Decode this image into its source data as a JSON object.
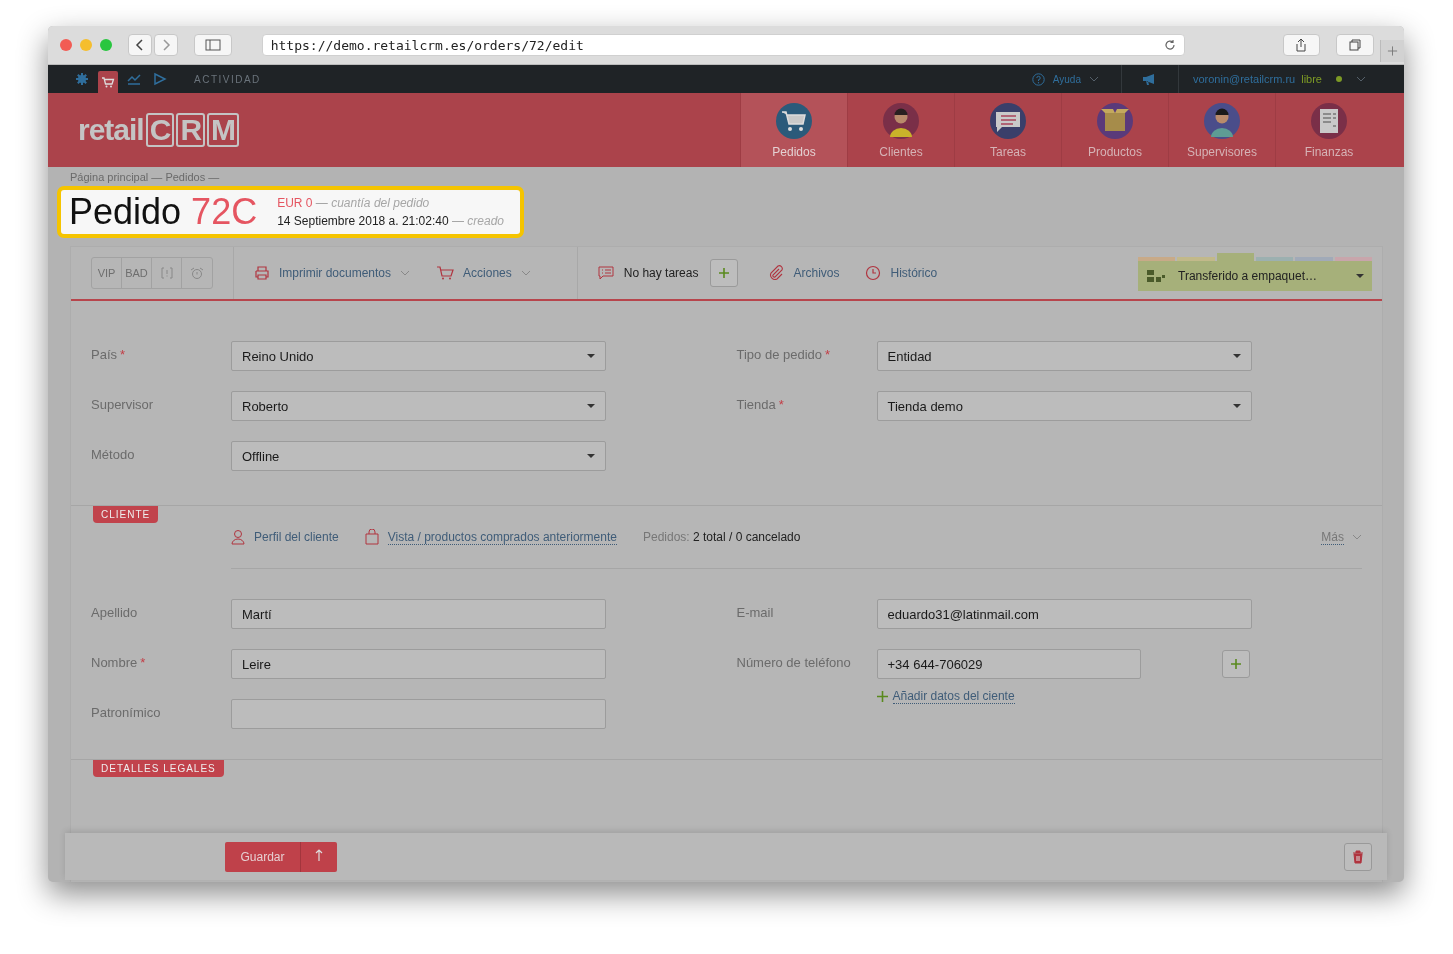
{
  "browser": {
    "url": "https://demo.retailcrm.es/orders/72/edit"
  },
  "topbar": {
    "modules": [
      {
        "selected": false
      },
      {
        "selected": true
      },
      {
        "selected": false
      },
      {
        "selected": false
      }
    ],
    "activity": "ACTIVIDAD",
    "help": "Ayuda",
    "user": "voronin@retailcrm.ru",
    "status": "libre",
    "online": true
  },
  "logo": {
    "word": "retail",
    "letters": [
      "C",
      "R",
      "M"
    ]
  },
  "nav": [
    {
      "label": "Pedidos",
      "selected": true
    },
    {
      "label": "Clientes",
      "selected": false
    },
    {
      "label": "Tareas",
      "selected": false
    },
    {
      "label": "Productos",
      "selected": false
    },
    {
      "label": "Supervisores",
      "selected": false
    },
    {
      "label": "Finanzas",
      "selected": false
    }
  ],
  "page": {
    "breadcrumb": "Página principal — Pedidos —",
    "title": "Pedido",
    "number": "72C",
    "amount": "EUR 0",
    "amount_note": "— cuantía del pedido",
    "date": "14 Septiembre 2018 a. 21:02:40",
    "date_note": "— creado"
  },
  "toolbar": {
    "tags": [
      "VIP",
      "BAD"
    ],
    "print": "Imprimir documentos",
    "actions": "Acciones",
    "tasks": "No hay tareas",
    "files": "Archivos",
    "history": "Histórico",
    "status": "Transferido a empaquet…",
    "status_groups": [
      {
        "color": "#c8aa88",
        "selected": false
      },
      {
        "color": "#c2b98a",
        "selected": false
      },
      {
        "color": "#a6b07a",
        "selected": true
      },
      {
        "color": "#9cb0b0",
        "selected": false
      },
      {
        "color": "#a1aab8",
        "selected": false
      },
      {
        "color": "#c8a5ab",
        "selected": false
      }
    ]
  },
  "order_left": [
    {
      "label": "País",
      "required_mark": "*",
      "value": "Reino Unido"
    },
    {
      "label": "Supervisor",
      "value": "Roberto"
    },
    {
      "label": "Método",
      "value": "Offline"
    }
  ],
  "order_right": [
    {
      "label": "Tipo de pedido",
      "required_mark": "*",
      "value": "Entidad"
    },
    {
      "label": "Tienda",
      "required_mark": "*",
      "value": "Tienda demo"
    }
  ],
  "client": {
    "section": "CLIENTE",
    "profile": "Perfil del cliente",
    "history": "Vista / productos comprados anteriormente",
    "orders_label": "Pedidos:",
    "orders": "2 total / 0 cancelado",
    "more": "Más"
  },
  "client_left": [
    {
      "label": "Apellido",
      "value": "Martí"
    },
    {
      "label": "Nombre",
      "required_mark": "*",
      "value": "Leire"
    },
    {
      "label": "Patronímico"
    }
  ],
  "client_right": [
    {
      "label": "E-mail",
      "value": "eduardo31@latinmail.com"
    },
    {
      "label": "Número de teléfono",
      "value": "+34 644-706029"
    }
  ],
  "add_data": "Añadir datos del ciente",
  "legal": {
    "section": "DETALLES LEGALES"
  },
  "footer": {
    "save": "Guardar"
  }
}
